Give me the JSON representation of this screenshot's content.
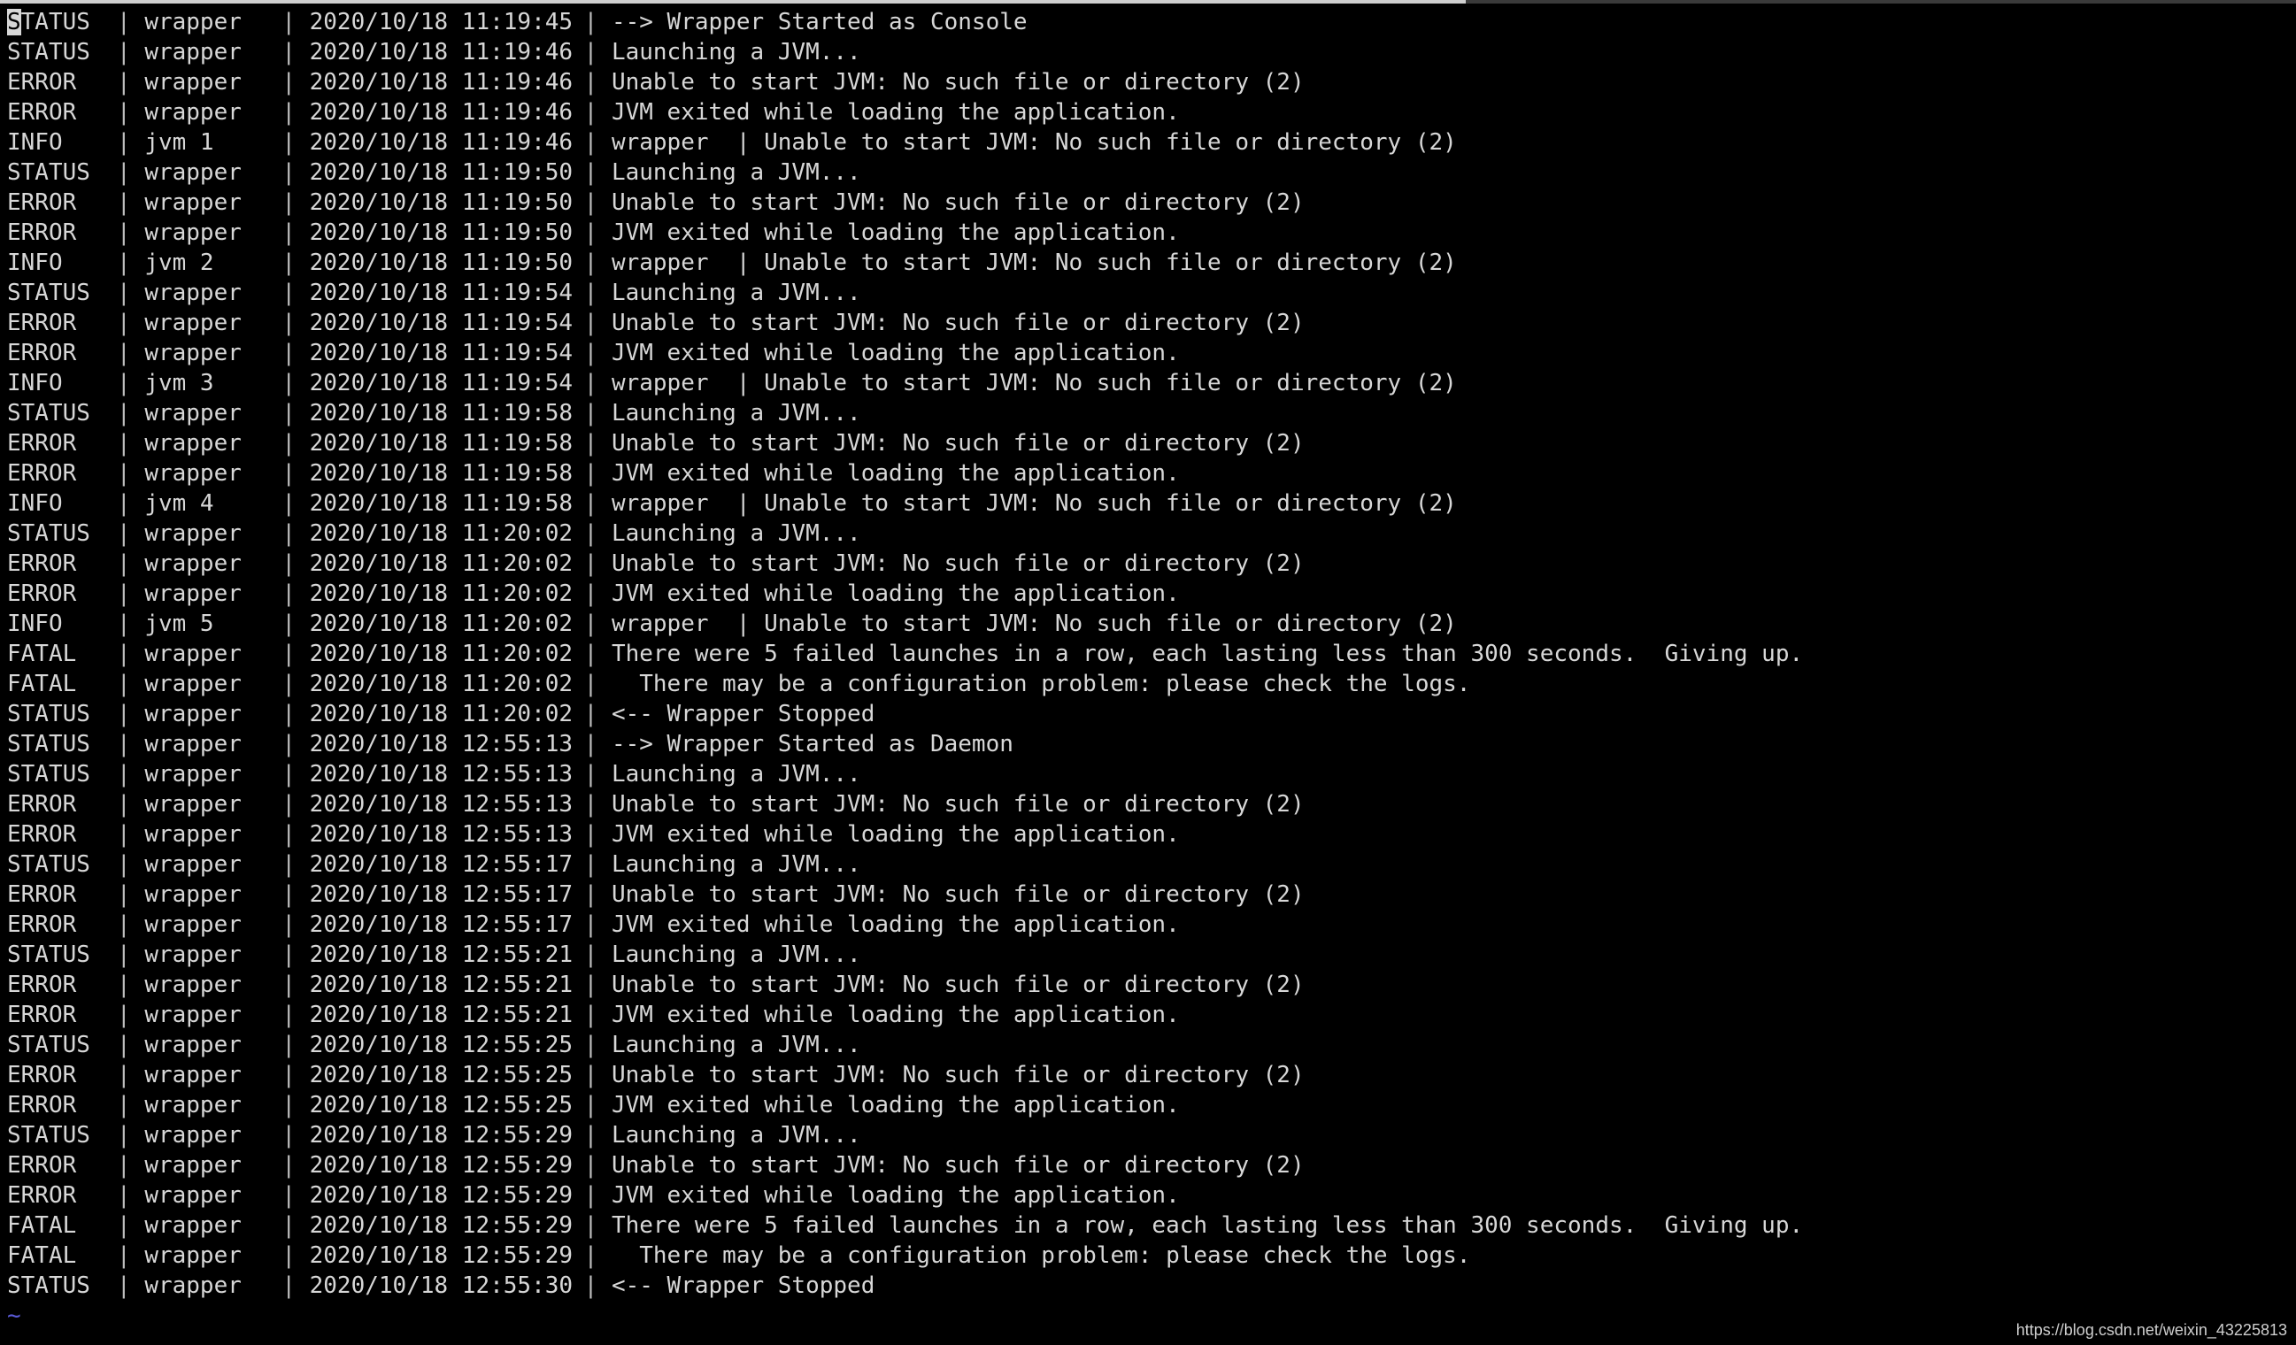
{
  "colors": {
    "background": "#000000",
    "text": "#d7d7d7",
    "tilde": "#5a5ad6"
  },
  "terminal": {
    "separator": "|",
    "cursor_char": "S",
    "lines": [
      {
        "level": "STATUS",
        "source": "wrapper",
        "timestamp": "2020/10/18 11:19:45",
        "message": "--> Wrapper Started as Console"
      },
      {
        "level": "STATUS",
        "source": "wrapper",
        "timestamp": "2020/10/18 11:19:46",
        "message": "Launching a JVM..."
      },
      {
        "level": "ERROR",
        "source": "wrapper",
        "timestamp": "2020/10/18 11:19:46",
        "message": "Unable to start JVM: No such file or directory (2)"
      },
      {
        "level": "ERROR",
        "source": "wrapper",
        "timestamp": "2020/10/18 11:19:46",
        "message": "JVM exited while loading the application."
      },
      {
        "level": "INFO",
        "source": "jvm 1",
        "timestamp": "2020/10/18 11:19:46",
        "message": "wrapper  | Unable to start JVM: No such file or directory (2)"
      },
      {
        "level": "STATUS",
        "source": "wrapper",
        "timestamp": "2020/10/18 11:19:50",
        "message": "Launching a JVM..."
      },
      {
        "level": "ERROR",
        "source": "wrapper",
        "timestamp": "2020/10/18 11:19:50",
        "message": "Unable to start JVM: No such file or directory (2)"
      },
      {
        "level": "ERROR",
        "source": "wrapper",
        "timestamp": "2020/10/18 11:19:50",
        "message": "JVM exited while loading the application."
      },
      {
        "level": "INFO",
        "source": "jvm 2",
        "timestamp": "2020/10/18 11:19:50",
        "message": "wrapper  | Unable to start JVM: No such file or directory (2)"
      },
      {
        "level": "STATUS",
        "source": "wrapper",
        "timestamp": "2020/10/18 11:19:54",
        "message": "Launching a JVM..."
      },
      {
        "level": "ERROR",
        "source": "wrapper",
        "timestamp": "2020/10/18 11:19:54",
        "message": "Unable to start JVM: No such file or directory (2)"
      },
      {
        "level": "ERROR",
        "source": "wrapper",
        "timestamp": "2020/10/18 11:19:54",
        "message": "JVM exited while loading the application."
      },
      {
        "level": "INFO",
        "source": "jvm 3",
        "timestamp": "2020/10/18 11:19:54",
        "message": "wrapper  | Unable to start JVM: No such file or directory (2)"
      },
      {
        "level": "STATUS",
        "source": "wrapper",
        "timestamp": "2020/10/18 11:19:58",
        "message": "Launching a JVM..."
      },
      {
        "level": "ERROR",
        "source": "wrapper",
        "timestamp": "2020/10/18 11:19:58",
        "message": "Unable to start JVM: No such file or directory (2)"
      },
      {
        "level": "ERROR",
        "source": "wrapper",
        "timestamp": "2020/10/18 11:19:58",
        "message": "JVM exited while loading the application."
      },
      {
        "level": "INFO",
        "source": "jvm 4",
        "timestamp": "2020/10/18 11:19:58",
        "message": "wrapper  | Unable to start JVM: No such file or directory (2)"
      },
      {
        "level": "STATUS",
        "source": "wrapper",
        "timestamp": "2020/10/18 11:20:02",
        "message": "Launching a JVM..."
      },
      {
        "level": "ERROR",
        "source": "wrapper",
        "timestamp": "2020/10/18 11:20:02",
        "message": "Unable to start JVM: No such file or directory (2)"
      },
      {
        "level": "ERROR",
        "source": "wrapper",
        "timestamp": "2020/10/18 11:20:02",
        "message": "JVM exited while loading the application."
      },
      {
        "level": "INFO",
        "source": "jvm 5",
        "timestamp": "2020/10/18 11:20:02",
        "message": "wrapper  | Unable to start JVM: No such file or directory (2)"
      },
      {
        "level": "FATAL",
        "source": "wrapper",
        "timestamp": "2020/10/18 11:20:02",
        "message": "There were 5 failed launches in a row, each lasting less than 300 seconds.  Giving up."
      },
      {
        "level": "FATAL",
        "source": "wrapper",
        "timestamp": "2020/10/18 11:20:02",
        "message": "  There may be a configuration problem: please check the logs."
      },
      {
        "level": "STATUS",
        "source": "wrapper",
        "timestamp": "2020/10/18 11:20:02",
        "message": "<-- Wrapper Stopped"
      },
      {
        "level": "STATUS",
        "source": "wrapper",
        "timestamp": "2020/10/18 12:55:13",
        "message": "--> Wrapper Started as Daemon"
      },
      {
        "level": "STATUS",
        "source": "wrapper",
        "timestamp": "2020/10/18 12:55:13",
        "message": "Launching a JVM..."
      },
      {
        "level": "ERROR",
        "source": "wrapper",
        "timestamp": "2020/10/18 12:55:13",
        "message": "Unable to start JVM: No such file or directory (2)"
      },
      {
        "level": "ERROR",
        "source": "wrapper",
        "timestamp": "2020/10/18 12:55:13",
        "message": "JVM exited while loading the application."
      },
      {
        "level": "STATUS",
        "source": "wrapper",
        "timestamp": "2020/10/18 12:55:17",
        "message": "Launching a JVM..."
      },
      {
        "level": "ERROR",
        "source": "wrapper",
        "timestamp": "2020/10/18 12:55:17",
        "message": "Unable to start JVM: No such file or directory (2)"
      },
      {
        "level": "ERROR",
        "source": "wrapper",
        "timestamp": "2020/10/18 12:55:17",
        "message": "JVM exited while loading the application."
      },
      {
        "level": "STATUS",
        "source": "wrapper",
        "timestamp": "2020/10/18 12:55:21",
        "message": "Launching a JVM..."
      },
      {
        "level": "ERROR",
        "source": "wrapper",
        "timestamp": "2020/10/18 12:55:21",
        "message": "Unable to start JVM: No such file or directory (2)"
      },
      {
        "level": "ERROR",
        "source": "wrapper",
        "timestamp": "2020/10/18 12:55:21",
        "message": "JVM exited while loading the application."
      },
      {
        "level": "STATUS",
        "source": "wrapper",
        "timestamp": "2020/10/18 12:55:25",
        "message": "Launching a JVM..."
      },
      {
        "level": "ERROR",
        "source": "wrapper",
        "timestamp": "2020/10/18 12:55:25",
        "message": "Unable to start JVM: No such file or directory (2)"
      },
      {
        "level": "ERROR",
        "source": "wrapper",
        "timestamp": "2020/10/18 12:55:25",
        "message": "JVM exited while loading the application."
      },
      {
        "level": "STATUS",
        "source": "wrapper",
        "timestamp": "2020/10/18 12:55:29",
        "message": "Launching a JVM..."
      },
      {
        "level": "ERROR",
        "source": "wrapper",
        "timestamp": "2020/10/18 12:55:29",
        "message": "Unable to start JVM: No such file or directory (2)"
      },
      {
        "level": "ERROR",
        "source": "wrapper",
        "timestamp": "2020/10/18 12:55:29",
        "message": "JVM exited while loading the application."
      },
      {
        "level": "FATAL",
        "source": "wrapper",
        "timestamp": "2020/10/18 12:55:29",
        "message": "There were 5 failed launches in a row, each lasting less than 300 seconds.  Giving up."
      },
      {
        "level": "FATAL",
        "source": "wrapper",
        "timestamp": "2020/10/18 12:55:29",
        "message": "  There may be a configuration problem: please check the logs."
      },
      {
        "level": "STATUS",
        "source": "wrapper",
        "timestamp": "2020/10/18 12:55:30",
        "message": "<-- Wrapper Stopped"
      }
    ],
    "empty_line_marker": "~"
  },
  "watermark": "https://blog.csdn.net/weixin_43225813"
}
